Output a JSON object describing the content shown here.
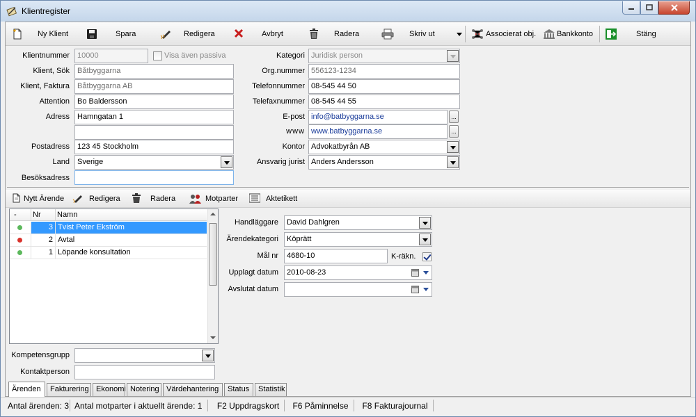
{
  "window": {
    "title": "Klientregister"
  },
  "toolbar": {
    "new_client": "Ny Klient",
    "save": "Spara",
    "edit": "Redigera",
    "cancel": "Avbryt",
    "delete": "Radera",
    "print": "Skriv ut",
    "associated": "Associerat obj.",
    "bank": "Bankkonto",
    "close": "Stäng"
  },
  "form": {
    "client_number": {
      "label": "Klientnummer",
      "value": "10000"
    },
    "show_passive": {
      "label": "Visa även passiva",
      "checked": false
    },
    "client_search": {
      "label": "Klient, Sök",
      "value": "Båtbyggarna"
    },
    "client_invoice": {
      "label": "Klient, Faktura",
      "value": "Båtbyggarna AB"
    },
    "attention": {
      "label": "Attention",
      "value": "Bo Baldersson"
    },
    "address": {
      "label": "Adress",
      "value": "Hamngatan 1",
      "value2": ""
    },
    "postal": {
      "label": "Postadress",
      "value": "123 45 Stockholm"
    },
    "country": {
      "label": "Land",
      "value": "Sverige"
    },
    "visit_address": {
      "label": "Besöksadress",
      "value": ""
    },
    "category": {
      "label": "Kategori",
      "value": "Juridisk person"
    },
    "org_number": {
      "label": "Org.nummer",
      "value": "556123-1234"
    },
    "phone": {
      "label": "Telefonnummer",
      "value": "08-545 44 50"
    },
    "fax": {
      "label": "Telefaxnummer",
      "value": "08-545 44 55"
    },
    "email": {
      "label": "E-post",
      "value": "info@batbyggarna.se"
    },
    "www": {
      "label": "www",
      "value": "www.batbyggarna.se"
    },
    "office": {
      "label": "Kontor",
      "value": "Advokatbyrån AB"
    },
    "lawyer": {
      "label": "Ansvarig jurist",
      "value": "Anders Andersson"
    }
  },
  "case_toolbar": {
    "new_case": "Nytt Ärende",
    "edit": "Redigera",
    "delete": "Radera",
    "counterparties": "Motparter",
    "file_label": "Aktetikett"
  },
  "cases": {
    "headers": {
      "status": "-",
      "nr": "Nr",
      "name": "Namn"
    },
    "rows": [
      {
        "nr": "3",
        "name": "Tvist Peter Ekström",
        "status_color": "#5cb85c",
        "selected": true
      },
      {
        "nr": "2",
        "name": "Avtal",
        "status_color": "#d9322b",
        "selected": false
      },
      {
        "nr": "1",
        "name": "Löpande konsultation",
        "status_color": "#5cb85c",
        "selected": false
      }
    ]
  },
  "case_detail": {
    "handler": {
      "label": "Handläggare",
      "value": "David Dahlgren"
    },
    "category": {
      "label": "Ärendekategori",
      "value": "Köprätt"
    },
    "case_number": {
      "label": "Mål nr",
      "value": "4680-10"
    },
    "k_calc": {
      "label": "K-räkn.",
      "checked": true
    },
    "created": {
      "label": "Upplagt datum",
      "value": "2010-08-23"
    },
    "closed": {
      "label": "Avslutat datum",
      "value": ""
    }
  },
  "bottom_fields": {
    "competence": {
      "label": "Kompetensgrupp",
      "value": ""
    },
    "contact": {
      "label": "Kontaktperson",
      "value": ""
    }
  },
  "tabs": [
    "Ärenden",
    "Fakturering",
    "Ekonomi",
    "Notering",
    "Värdehantering",
    "Status",
    "Statistik"
  ],
  "statusbar": {
    "case_count": "Antal ärenden: 3",
    "counterparty_count": "Antal motparter i aktuellt ärende: 1",
    "f2": "F2 Uppdragskort",
    "f6": "F6 Påminnelse",
    "f8": "F8 Fakturajournal"
  }
}
